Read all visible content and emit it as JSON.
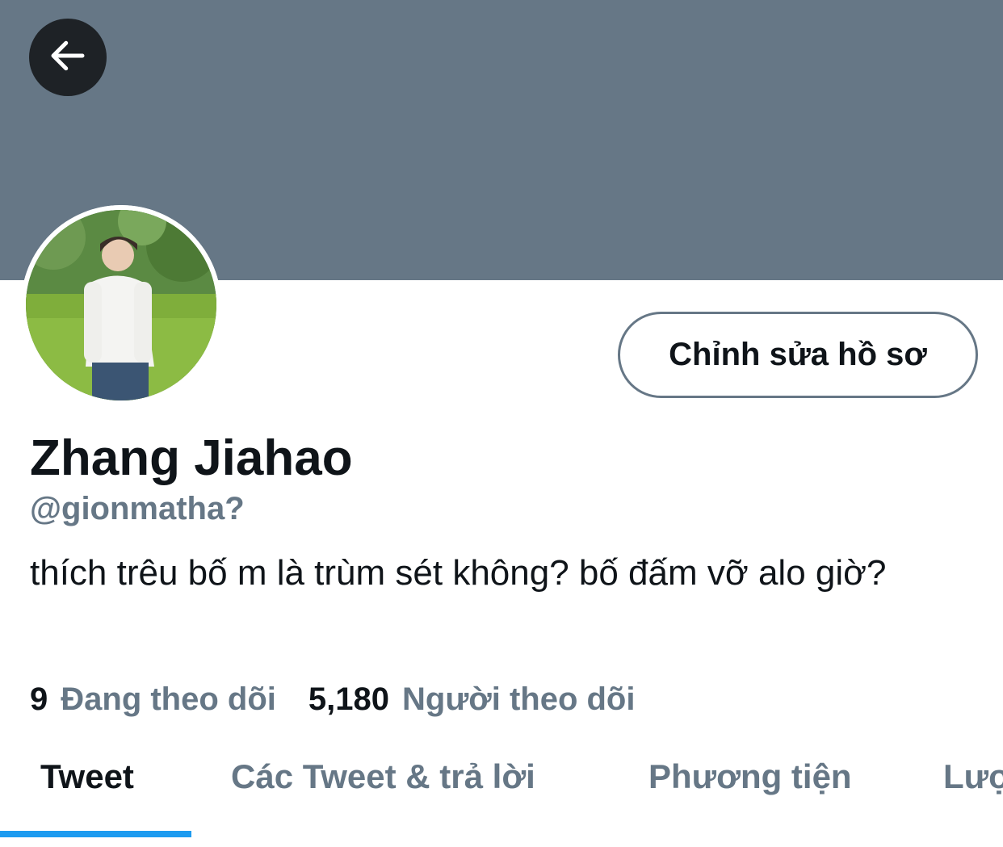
{
  "header": {
    "back_icon": "arrow-left-icon"
  },
  "profile": {
    "edit_button_label": "Chỉnh sửa hồ sơ",
    "display_name": "Zhang Jiahao",
    "handle": "@gionmatha?",
    "bio": "thích trêu bố m là trùm sét không? bố đấm vỡ alo giờ?",
    "following_count": "9",
    "following_label": "Đang theo dõi",
    "followers_count": "5,180",
    "followers_label": "Người theo dõi"
  },
  "tabs": [
    {
      "label": "Tweet",
      "active": true
    },
    {
      "label": "Các Tweet & trả lời",
      "active": false
    },
    {
      "label": "Phương tiện",
      "active": false
    },
    {
      "label": "Lượt thích",
      "active": false
    }
  ],
  "colors": {
    "banner": "#667786",
    "accent": "#1d9bf0",
    "text": "#0f1419",
    "muted": "#667786"
  }
}
